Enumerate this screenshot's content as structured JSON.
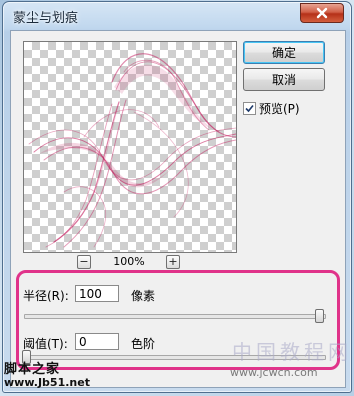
{
  "window": {
    "title": "蒙尘与划痕",
    "close_icon": "close-icon"
  },
  "buttons": {
    "ok": "确定",
    "cancel": "取消"
  },
  "preview_option": {
    "label": "预览(P)",
    "checked": true
  },
  "zoom": {
    "minus": "−",
    "level": "100%",
    "plus": "+"
  },
  "radius": {
    "label": "半径(R):",
    "value": "100",
    "unit": "像素"
  },
  "threshold": {
    "label": "阈值(T):",
    "value": "0",
    "unit": "色阶"
  },
  "watermarks": {
    "left_cn": "脚本之家",
    "left_url": "www.Jb51.net",
    "right_cn": "中国教程网",
    "right_url": "www.jcwcn.com"
  },
  "colors": {
    "highlight": "#e0338a",
    "smoke": "#c2185b"
  }
}
